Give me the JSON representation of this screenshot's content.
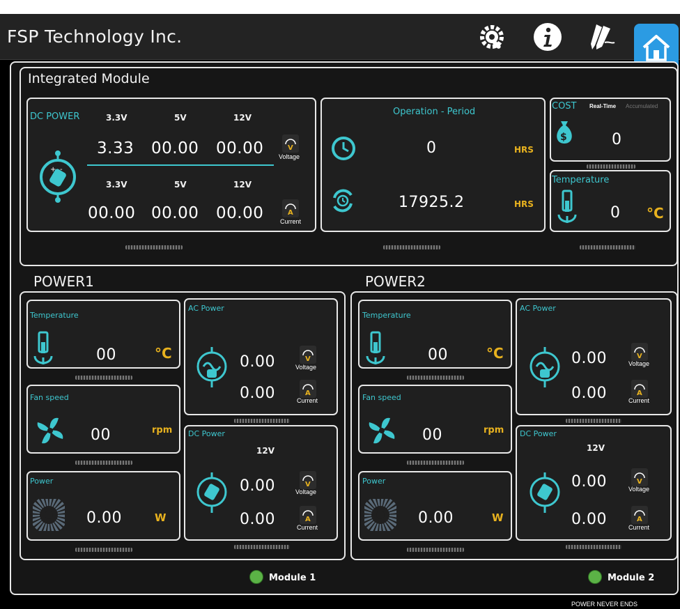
{
  "app": {
    "title": "FSP Technology Inc.",
    "footer": "POWER NEVER ENDS",
    "accent": "#3ec7cf",
    "unit_color": "#e8b21f",
    "home_color": "#2b9be3"
  },
  "toolbar": {
    "icons": [
      "settings-gear-icon",
      "info-icon",
      "edit-pen-icon",
      "home-icon"
    ]
  },
  "integrated": {
    "title": "Integrated Module",
    "dc_power": {
      "label": "DC POWER",
      "rails": [
        "3.3V",
        "5V",
        "12V"
      ],
      "voltage_values": [
        "3.33",
        "00.00",
        "00.00"
      ],
      "current_values": [
        "00.00",
        "00.00",
        "00.00"
      ],
      "voltage_label": "Voltage",
      "current_label": "Current"
    },
    "operation": {
      "label": "Operation - Period",
      "value1": "0",
      "value2": "17925.2",
      "unit": "HRS"
    },
    "cost": {
      "label": "COST",
      "tab_realtime": "Real-Time",
      "tab_accumulated": "Accumulated",
      "value": "0"
    },
    "temperature": {
      "label": "Temperature",
      "value": "0",
      "unit": "°C"
    }
  },
  "power1": {
    "title": "POWER1",
    "temperature": {
      "label": "Temperature",
      "value": "00",
      "unit": "°C"
    },
    "fan": {
      "label": "Fan speed",
      "value": "00",
      "unit": "rpm"
    },
    "power": {
      "label": "Power",
      "value": "0.00",
      "unit": "W"
    },
    "ac": {
      "label": "AC Power",
      "voltage": "0.00",
      "current": "0.00",
      "voltage_label": "Voltage",
      "current_label": "Current"
    },
    "dc": {
      "label": "DC Power",
      "rail": "12V",
      "voltage": "0.00",
      "current": "0.00",
      "voltage_label": "Voltage",
      "current_label": "Current"
    }
  },
  "power2": {
    "title": "POWER2",
    "temperature": {
      "label": "Temperature",
      "value": "00",
      "unit": "°C"
    },
    "fan": {
      "label": "Fan speed",
      "value": "00",
      "unit": "rpm"
    },
    "power": {
      "label": "Power",
      "value": "0.00",
      "unit": "W"
    },
    "ac": {
      "label": "AC Power",
      "voltage": "0.00",
      "current": "0.00",
      "voltage_label": "Voltage",
      "current_label": "Current"
    },
    "dc": {
      "label": "DC Power",
      "rail": "12V",
      "voltage": "0.00",
      "current": "0.00",
      "voltage_label": "Voltage",
      "current_label": "Current"
    }
  },
  "modules": [
    {
      "label": "Module 1",
      "status_color": "#5bb246"
    },
    {
      "label": "Module 2",
      "status_color": "#5bb246"
    }
  ]
}
